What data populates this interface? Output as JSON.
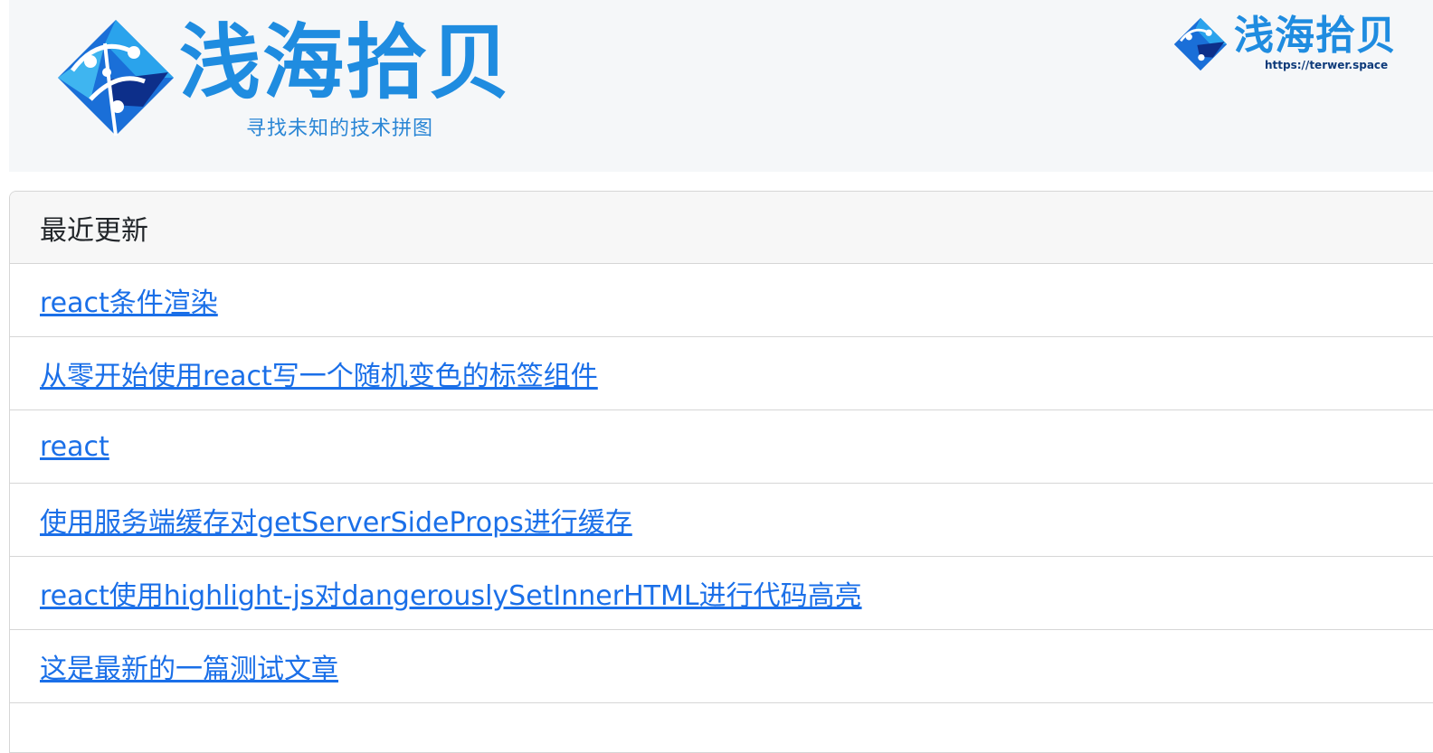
{
  "header": {
    "brand_title": "浅海拾贝",
    "brand_tagline": "寻找未知的技术拼图",
    "small_logo_title": "浅海拾贝",
    "small_logo_url": "https://terwer.space",
    "logo_icon": "diamond-network-logo-icon",
    "accent_color": "#1f8ce0"
  },
  "recent": {
    "heading": "最近更新",
    "items": [
      {
        "label": "react条件渲染"
      },
      {
        "label": "从零开始使用react写一个随机变色的标签组件"
      },
      {
        "label": "react"
      },
      {
        "label": "使用服务端缓存对getServerSideProps进行缓存"
      },
      {
        "label": "react使用highlight-js对dangerouslySetInnerHTML进行代码高亮"
      },
      {
        "label": "这是最新的一篇测试文章"
      }
    ],
    "link_color": "#1a6fe8"
  }
}
